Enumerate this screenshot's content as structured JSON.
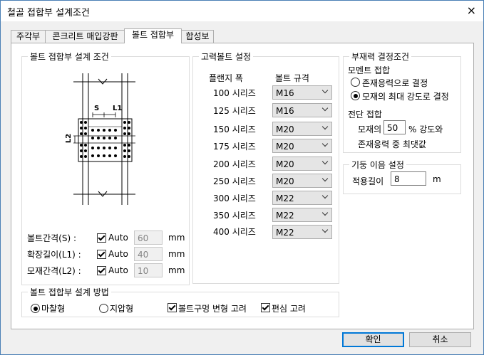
{
  "window": {
    "title": "철골 접합부 설계조건",
    "close_icon": "×"
  },
  "tabs": [
    "주각부",
    "콘크리트 매입강판",
    "볼트 접합부",
    "합성보"
  ],
  "design_conditions": {
    "title": "볼트 접합부 설계 조건",
    "dims": {
      "s": "S",
      "l1": "L1",
      "l2": "L2"
    },
    "rows": [
      {
        "label": "볼트간격(S) :",
        "auto_label": "Auto",
        "value": "60",
        "unit": "mm"
      },
      {
        "label": "확장길이(L1) :",
        "auto_label": "Auto",
        "value": "40",
        "unit": "mm"
      },
      {
        "label": "모재간격(L2) :",
        "auto_label": "Auto",
        "value": "10",
        "unit": "mm"
      }
    ]
  },
  "hs_bolt": {
    "title": "고력볼트 설정",
    "col_flange": "플랜지 폭",
    "col_bolt": "볼트 규격",
    "rows": [
      {
        "series": "100 시리즈",
        "bolt": "M16"
      },
      {
        "series": "125 시리즈",
        "bolt": "M16"
      },
      {
        "series": "150 시리즈",
        "bolt": "M20"
      },
      {
        "series": "175 시리즈",
        "bolt": "M20"
      },
      {
        "series": "200 시리즈",
        "bolt": "M20"
      },
      {
        "series": "250 시리즈",
        "bolt": "M20"
      },
      {
        "series": "300 시리즈",
        "bolt": "M22"
      },
      {
        "series": "350 시리즈",
        "bolt": "M22"
      },
      {
        "series": "400 시리즈",
        "bolt": "M22"
      }
    ]
  },
  "member_force": {
    "title": "부재력 결정조건",
    "moment_title": "모멘트 접합",
    "moment_opt1": "존재응력으로 결정",
    "moment_opt2": "모재의 최대 강도로 결정",
    "shear_title": "전단 접합",
    "shear_prefix": "모재의",
    "shear_value": "50",
    "shear_suffix": "% 강도와",
    "shear_line2": "존재응력 중 최댓값"
  },
  "column_splice": {
    "title": "기둥 이음 설정",
    "label": "적용길이",
    "value": "8",
    "unit": "m"
  },
  "design_method": {
    "title": "볼트 접합부 설계 방법",
    "opt_friction": "마찰형",
    "opt_bearing": "지압형",
    "chk_hole": "볼트구멍 변형 고려",
    "chk_eccentric": "편심 고려"
  },
  "buttons": {
    "ok": "확인",
    "cancel": "취소"
  }
}
